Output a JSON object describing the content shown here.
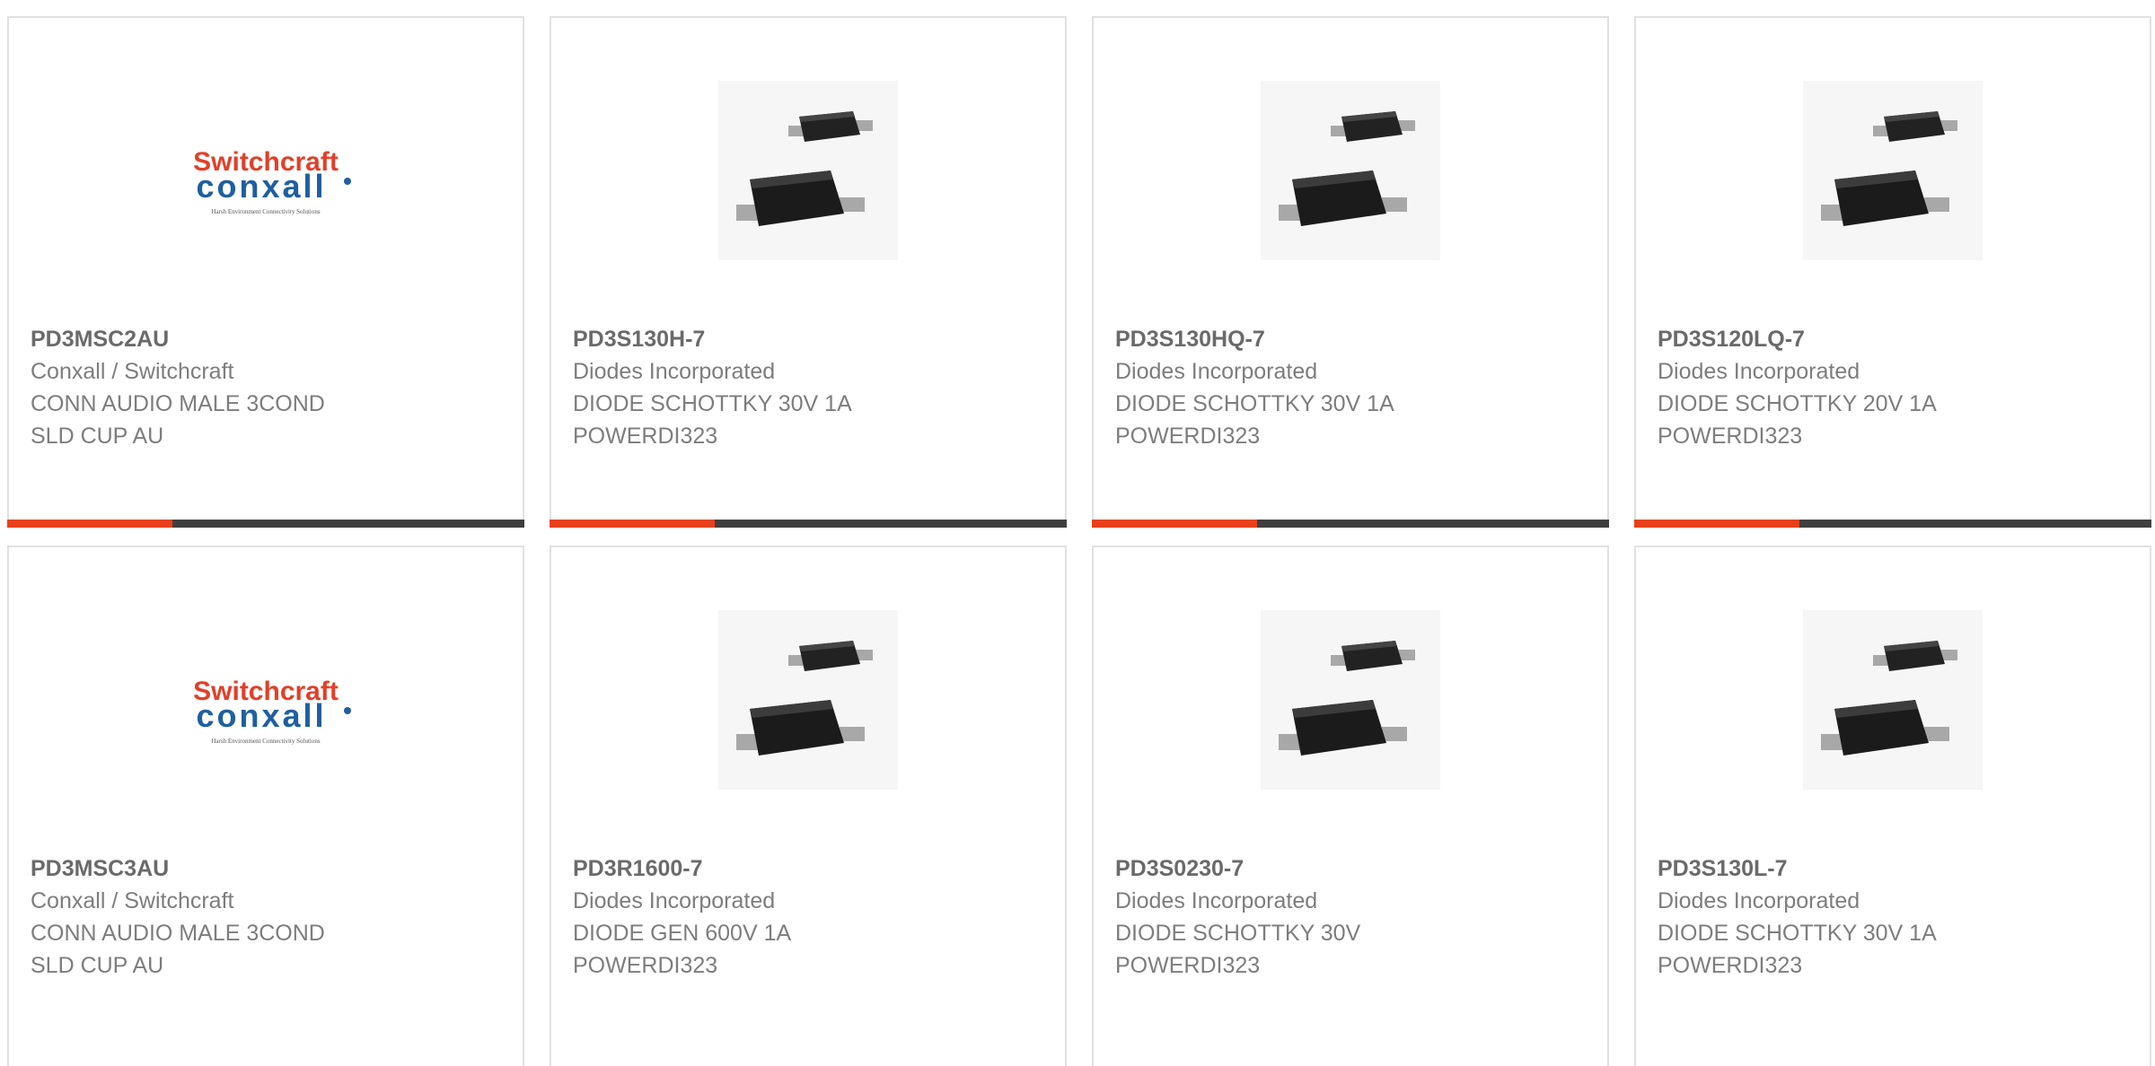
{
  "accent_color": "#e8401c",
  "bar_color": "#3f3f3f",
  "products": [
    {
      "part_number": "PD3MSC2AU",
      "manufacturer": "Conxall / Switchcraft",
      "description": "CONN AUDIO MALE 3COND\nSLD CUP AU",
      "image": "switchcraft-conxall-logo",
      "logo": {
        "brand_top": "Switchcraft",
        "brand_bottom": "conxall",
        "tagline": "Harsh Environment Connectivity Solutions"
      }
    },
    {
      "part_number": "PD3S130H-7",
      "manufacturer": "Diodes Incorporated",
      "description": "DIODE SCHOTTKY 30V 1A\nPOWERDI323",
      "image": "smd-diode-package-photo"
    },
    {
      "part_number": "PD3S130HQ-7",
      "manufacturer": "Diodes Incorporated",
      "description": "DIODE SCHOTTKY 30V 1A\nPOWERDI323",
      "image": "smd-diode-package-photo"
    },
    {
      "part_number": "PD3S120LQ-7",
      "manufacturer": "Diodes Incorporated",
      "description": "DIODE SCHOTTKY 20V 1A\nPOWERDI323",
      "image": "smd-diode-package-photo"
    },
    {
      "part_number": "PD3MSC3AU",
      "manufacturer": "Conxall / Switchcraft",
      "description": "CONN AUDIO MALE 3COND\nSLD CUP AU",
      "image": "switchcraft-conxall-logo",
      "logo": {
        "brand_top": "Switchcraft",
        "brand_bottom": "conxall",
        "tagline": "Harsh Environment Connectivity Solutions"
      }
    },
    {
      "part_number": "PD3R1600-7",
      "manufacturer": "Diodes Incorporated",
      "description": "DIODE GEN 600V 1A\nPOWERDI323",
      "image": "smd-diode-package-photo"
    },
    {
      "part_number": "PD3S0230-7",
      "manufacturer": "Diodes Incorporated",
      "description": "DIODE SCHOTTKY 30V\nPOWERDI323",
      "image": "smd-diode-package-photo"
    },
    {
      "part_number": "PD3S130L-7",
      "manufacturer": "Diodes Incorporated",
      "description": "DIODE SCHOTTKY 30V 1A\nPOWERDI323",
      "image": "smd-diode-package-photo"
    }
  ]
}
